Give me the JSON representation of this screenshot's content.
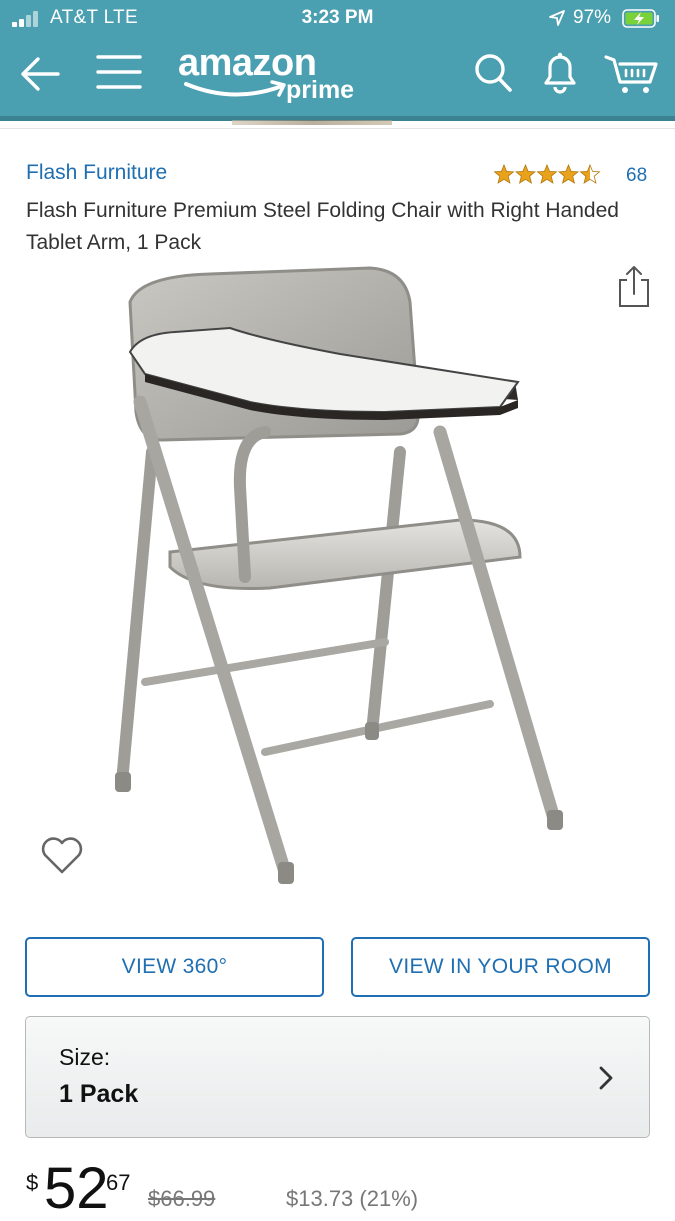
{
  "status_bar": {
    "carrier": "AT&T  LTE",
    "time": "3:23 PM",
    "battery": "97%"
  },
  "nav": {
    "logo_word": "amazon",
    "logo_sub": "prime",
    "back_icon": "back-arrow-icon",
    "menu_icon": "hamburger-menu-icon",
    "search_icon": "search-icon",
    "notifications_icon": "bell-icon",
    "cart_icon": "cart-icon",
    "bar_color": "#4a9fb0"
  },
  "product": {
    "brand": "Flash Furniture",
    "rating_stars": 4.5,
    "rating_count": "68",
    "title": "Flash Furniture Premium Steel Folding Chair with Right Handed Tablet Arm, 1 Pack",
    "image_icon": "folding-chair-with-tablet-arm",
    "share_icon": "share-icon",
    "wishlist_icon": "heart-icon"
  },
  "actions": {
    "view_360": "VIEW 360°",
    "view_in_room": "VIEW IN YOUR ROOM"
  },
  "size": {
    "label": "Size:",
    "value": "1 Pack"
  },
  "price": {
    "currency": "$",
    "dollars": "52",
    "cents": "67",
    "list_price": "$66.99",
    "savings": "$13.73 (21%)"
  },
  "colors": {
    "link": "#1f6fb2",
    "star": "#e8a21b"
  }
}
